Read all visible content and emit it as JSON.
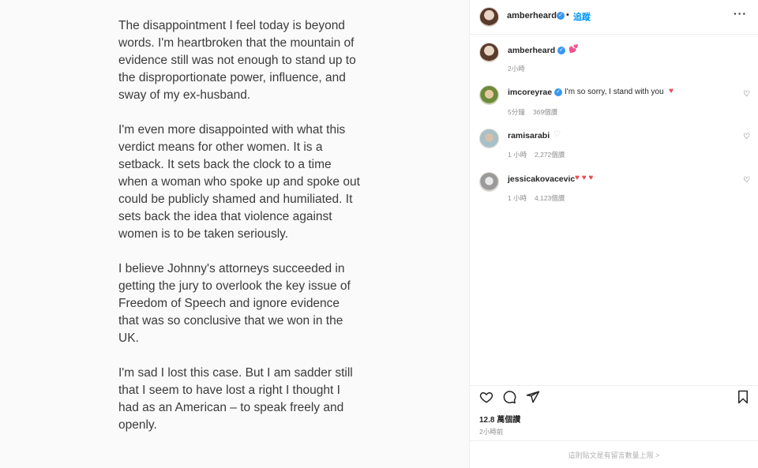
{
  "media": {
    "paragraphs": [
      "The disappointment I feel today is beyond words. I'm heartbroken that the mountain of evidence still was not enough to stand up to the disproportionate power, influence, and sway of my ex-husband.",
      "I'm even more disappointed with what this verdict means for other women. It is a setback. It sets back the clock to a time when a woman who spoke up and spoke out could be publicly shamed and humiliated. It sets back the idea that violence against women is to be taken seriously.",
      "I believe Johnny's attorneys succeeded in getting the jury to overlook the key issue of Freedom of Speech and ignore evidence that was so conclusive that we won in the UK.",
      "I'm sad I lost this case. But I am sadder still that I seem to have lost a right I thought I had as an American – to speak freely and openly."
    ]
  },
  "header": {
    "username": "amberheard",
    "separator": "•",
    "follow_label": "追蹤",
    "more_label": "···"
  },
  "caption": {
    "username": "amberheard",
    "text": "💕",
    "time": "2小時"
  },
  "comments": [
    {
      "username": "imcoreyrae",
      "text": "I'm so sorry, I stand with you",
      "emoji": "♥",
      "time": "5分鐘",
      "likes": "369個讚",
      "verified": true
    },
    {
      "username": "ramisarabi",
      "text": "♡",
      "emoji": "",
      "time": "1 小時",
      "likes": "2,272個讚",
      "verified": false
    },
    {
      "username": "jessicakovacevic",
      "text": "",
      "emoji": "♥ ♥ ♥",
      "time": "1 小時",
      "likes": "4,123個讚",
      "verified": false
    }
  ],
  "post": {
    "likes": "12.8 萬個讚",
    "time": "2小時前",
    "footer": "這則貼文是有留言數量上限 >"
  },
  "colors": {
    "accent": "#0095f6",
    "verified": "#3897f0",
    "heart_red": "#ed4956",
    "muted": "#8e8e8e"
  }
}
